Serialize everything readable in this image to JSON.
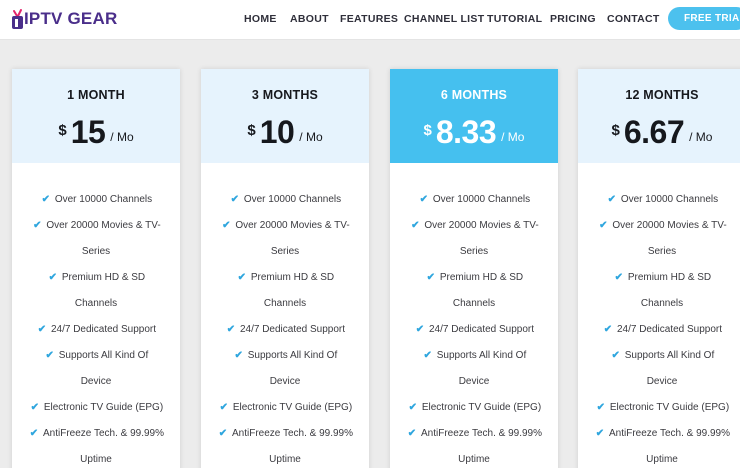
{
  "brand": {
    "name": "IPTV GEAR"
  },
  "nav": {
    "items": [
      "HOME",
      "ABOUT",
      "FEATURES",
      "CHANNEL LIST",
      "TUTORIAL",
      "PRICING",
      "CONTACT"
    ],
    "cta_label": "FREE TRIAL"
  },
  "colors": {
    "accent": "#45c0ef",
    "brand": "#4a2e8a",
    "header_bg": "#e6f3fd",
    "check": "#2fa6de"
  },
  "plans": [
    {
      "name": "1 MONTH",
      "currency": "$",
      "price": "15",
      "per": "/ Mo",
      "featured": false
    },
    {
      "name": "3 MONTHS",
      "currency": "$",
      "price": "10",
      "per": "/ Mo",
      "featured": false
    },
    {
      "name": "6 MONTHS",
      "currency": "$",
      "price": "8.33",
      "per": "/ Mo",
      "featured": true
    },
    {
      "name": "12 MONTHS",
      "currency": "$",
      "price": "6.67",
      "per": "/ Mo",
      "featured": false
    }
  ],
  "features": [
    {
      "line1": "Over 10000 Channels",
      "line2": ""
    },
    {
      "line1": "Over 20000 Movies & TV-",
      "line2": "Series"
    },
    {
      "line1": "Premium HD & SD",
      "line2": "Channels"
    },
    {
      "line1": "24/7 Dedicated Support",
      "line2": ""
    },
    {
      "line1": "Supports All Kind Of",
      "line2": "Device"
    },
    {
      "line1": "Electronic TV Guide (EPG)",
      "line2": ""
    },
    {
      "line1": "AntiFreeze Tech. & 99.99%",
      "line2": "Uptime"
    }
  ],
  "icons": {
    "check": "check-icon",
    "logo": "tv-icon"
  }
}
